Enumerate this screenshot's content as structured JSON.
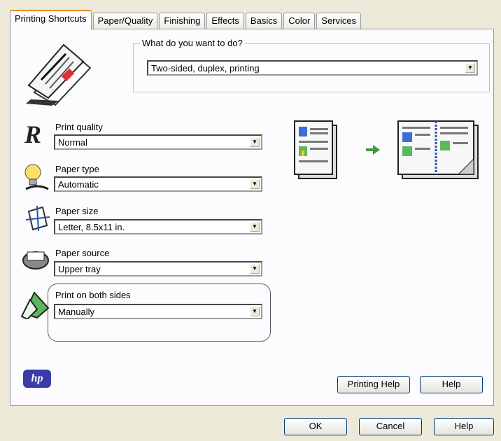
{
  "tabs": [
    "Printing Shortcuts",
    "Paper/Quality",
    "Finishing",
    "Effects",
    "Basics",
    "Color",
    "Services"
  ],
  "what_to_do": {
    "title": "What do you want to do?",
    "value": "Two-sided, duplex, printing"
  },
  "settings": [
    {
      "label": "Print quality",
      "value": "Normal",
      "icon": "print-quality-icon"
    },
    {
      "label": "Paper type",
      "value": "Automatic",
      "icon": "paper-type-icon"
    },
    {
      "label": "Paper size",
      "value": "Letter, 8.5x11 in.",
      "icon": "paper-size-icon"
    },
    {
      "label": "Paper source",
      "value": "Upper tray",
      "icon": "paper-source-icon"
    },
    {
      "label": "Print on both sides",
      "value": "Manually",
      "icon": "print-both-sides-icon"
    }
  ],
  "logo": "hp",
  "panel_buttons": {
    "printing_help": "Printing Help",
    "help": "Help"
  },
  "dialog_buttons": {
    "ok": "OK",
    "cancel": "Cancel",
    "help": "Help"
  }
}
